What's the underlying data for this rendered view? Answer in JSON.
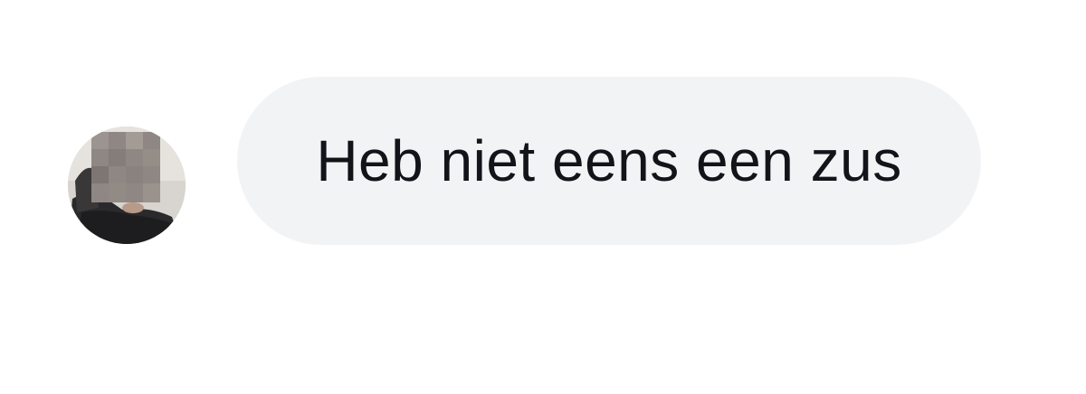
{
  "message": {
    "text": "Heb niet eens een zus",
    "bubble_color": "#f2f3f5",
    "text_color": "#111418"
  },
  "sender": {
    "avatar_icon": "profile-photo-avatar",
    "avatar_blurred": true
  }
}
